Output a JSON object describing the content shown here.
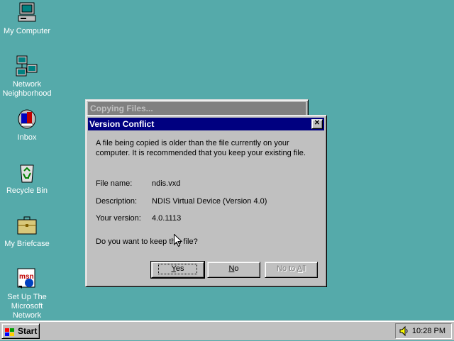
{
  "desktop": {
    "icons": [
      {
        "label": "My Computer",
        "icon": "computer-icon"
      },
      {
        "label": "Network Neighborhood",
        "icon": "network-icon"
      },
      {
        "label": "Inbox",
        "icon": "inbox-icon"
      },
      {
        "label": "Recycle Bin",
        "icon": "recycle-bin-icon"
      },
      {
        "label": "My Briefcase",
        "icon": "briefcase-icon"
      },
      {
        "label": "Set Up The Microsoft Network",
        "icon": "msn-icon"
      }
    ]
  },
  "background_window": {
    "title": "Copying Files..."
  },
  "dialog": {
    "title": "Version Conflict",
    "close_symbol": "✕",
    "message": "A file being copied is older than the file currently on your computer. It is recommended that you keep your existing file.",
    "fields": {
      "file_name_label": "File name:",
      "file_name_value": "ndis.vxd",
      "description_label": "Description:",
      "description_value": "NDIS Virtual Device  (Version 4.0)",
      "version_label": "Your version:",
      "version_value": "4.0.1113"
    },
    "question": "Do you want to keep this file?",
    "buttons": {
      "yes_prefix": "Y",
      "yes_rest": "es",
      "no_prefix": "N",
      "no_rest": "o",
      "no_to_all_pre": "No to ",
      "no_to_all_key": "A",
      "no_to_all_rest": "ll"
    }
  },
  "taskbar": {
    "start_label": "Start",
    "clock": "10:28 PM"
  },
  "colors": {
    "desktop": "#55AAAA",
    "title_active": "#000080",
    "title_inactive": "#808080",
    "face": "#C0C0C0"
  }
}
